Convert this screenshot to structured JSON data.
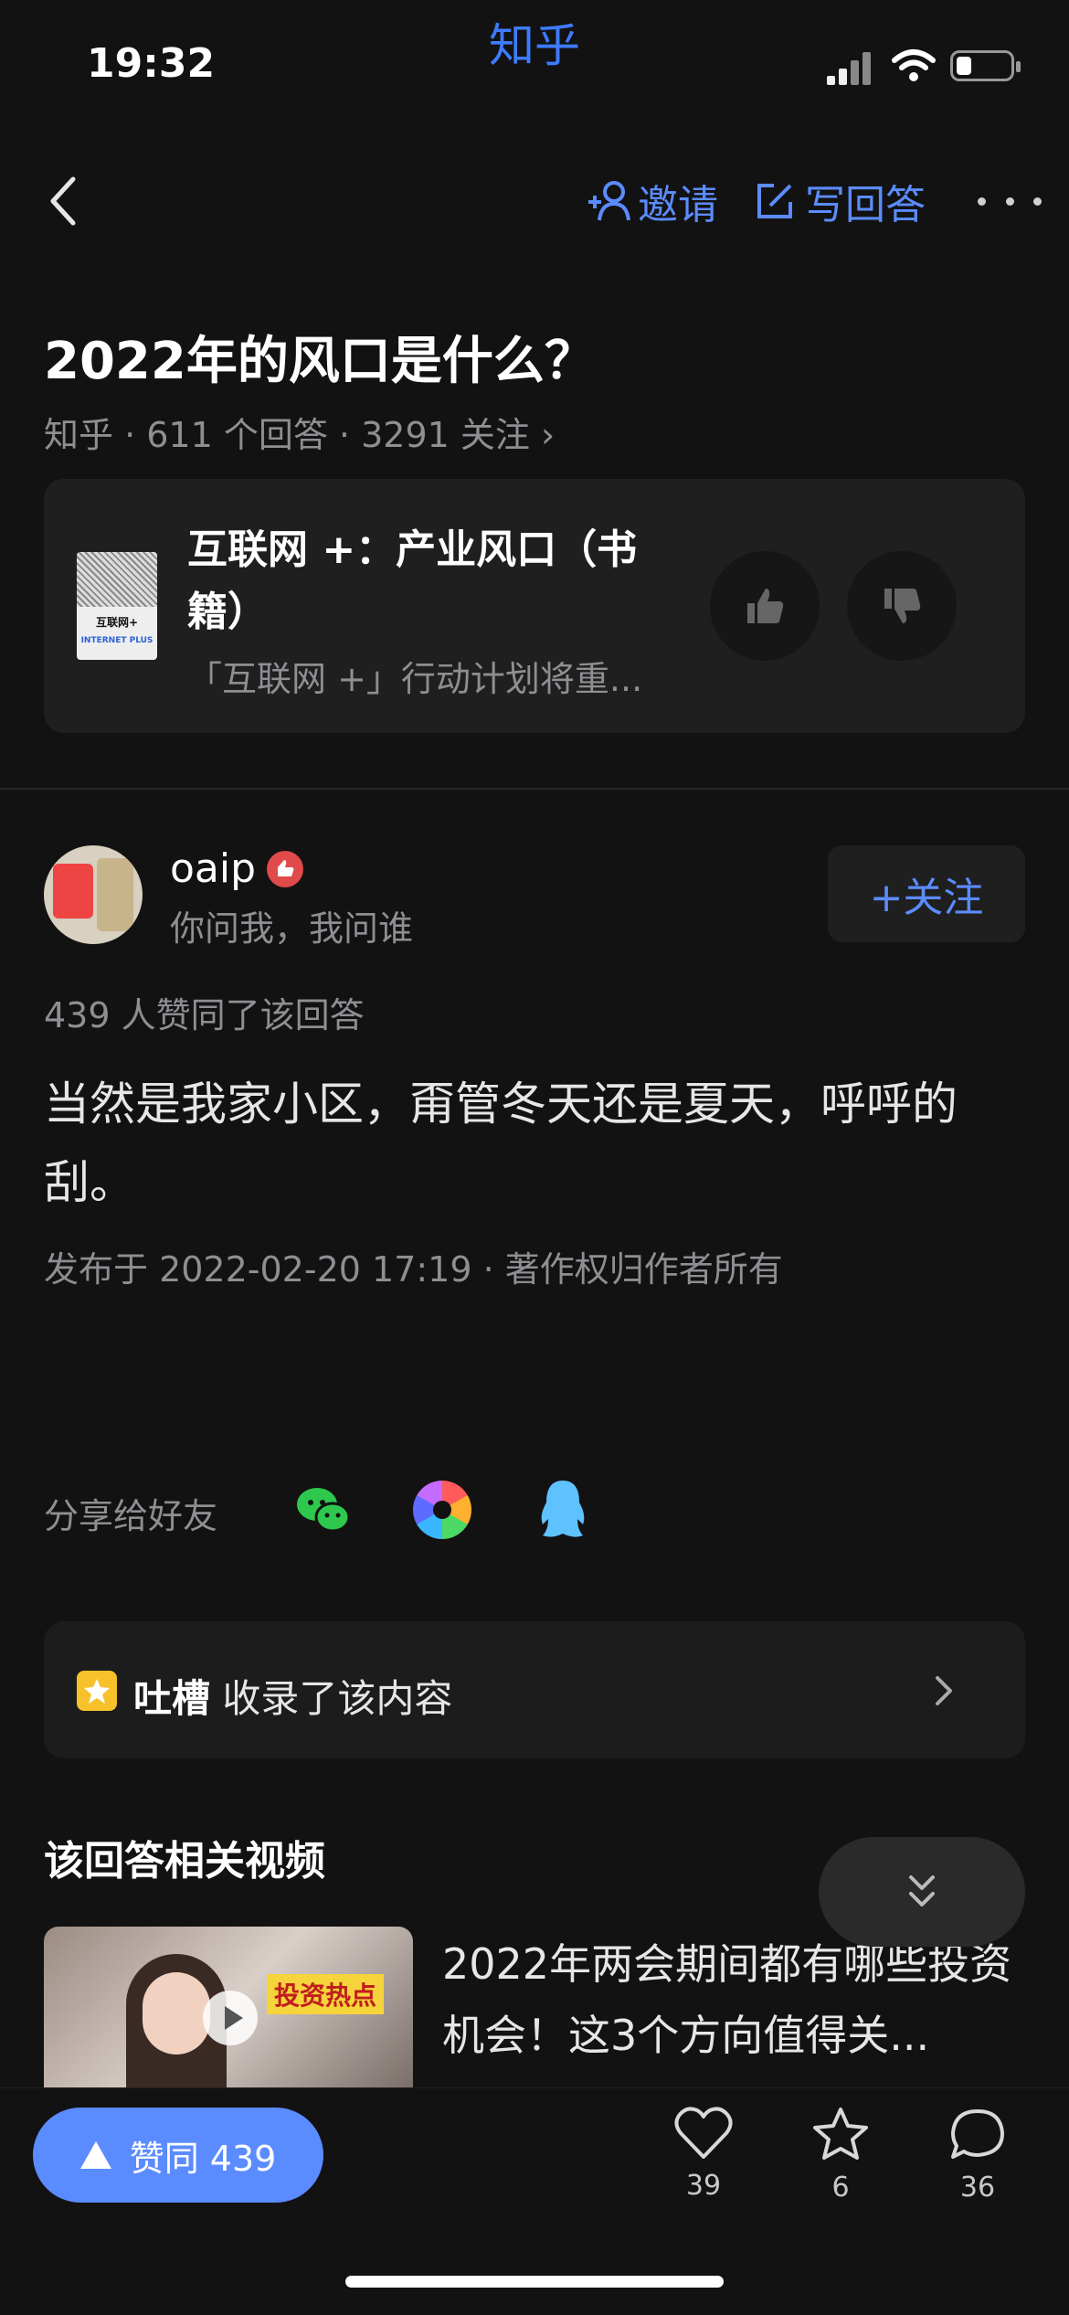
{
  "status": {
    "time": "19:32",
    "app_name": "知乎"
  },
  "nav": {
    "invite_label": "邀请",
    "write_answer_label": "写回答"
  },
  "question": {
    "title": "2022年的风口是什么？",
    "meta": "知乎 · 611 个回答 · 3291 关注 ›"
  },
  "book": {
    "cover_title": "互联网+",
    "cover_subtitle": "INTERNET PLUS",
    "title": "互联网 +：产业风口（书籍）",
    "desc": "「互联网 +」行动计划将重..."
  },
  "answer": {
    "author": "oaip",
    "bio": "你问我，我问谁",
    "follow_label": "+关注",
    "likes_line": "439 人赞同了该回答",
    "content": "当然是我家小区，甭管冬天还是夏天，呼呼的刮。",
    "published": "发布于 2022-02-20 17:19 · 著作权归作者所有"
  },
  "share": {
    "label": "分享给好友"
  },
  "collect": {
    "name": "吐槽",
    "text": "收录了该内容"
  },
  "related": {
    "title": "该回答相关视频",
    "video_tag": "投资热点",
    "video_title": "2022年两会期间都有哪些投资机会！这3个方向值得关..."
  },
  "bottom": {
    "vote_label": "赞同 439",
    "like_count": "39",
    "star_count": "6",
    "comment_count": "36"
  },
  "colors": {
    "accent": "#5b8cff",
    "brand": "#3d7bff",
    "background": "#121212"
  }
}
